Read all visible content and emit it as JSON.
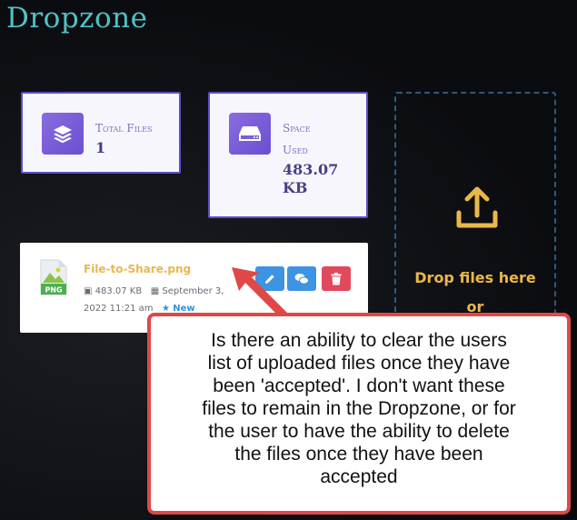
{
  "header": {
    "title": "Dropzone"
  },
  "stats": {
    "total_files": {
      "label_line1": "Total Files",
      "value": "1",
      "icon": "layers-icon"
    },
    "space_used": {
      "label_line1": "Space",
      "label_line2": "Used",
      "value_line1": "483.07",
      "value_line2": "KB",
      "icon": "hard-drive-icon"
    }
  },
  "dropzone": {
    "line1": "Drop files here",
    "line2": "or",
    "icon": "upload-icon"
  },
  "file": {
    "name": "File-to-Share.png",
    "thumb_label": "PNG",
    "size": "483.07 KB",
    "date_part1": "September 3,",
    "date_part2": "2022 11:21 am",
    "badge": "New",
    "actions": [
      "edit",
      "comments",
      "delete"
    ]
  },
  "callout": {
    "lines": [
      "Is there an ability to clear the users",
      "list of uploaded files once they have",
      "been 'accepted'.  I don't want these",
      "files to remain in the Dropzone, or for",
      "the user to have the ability to delete",
      "the files once they have been",
      "accepted"
    ]
  },
  "colors": {
    "accent": "#4ec3c6",
    "purple": "#6a4fd0",
    "yellow": "#e9b84b",
    "blue": "#3e93e3",
    "red": "#e14a5c",
    "callout_border": "#e04848"
  }
}
